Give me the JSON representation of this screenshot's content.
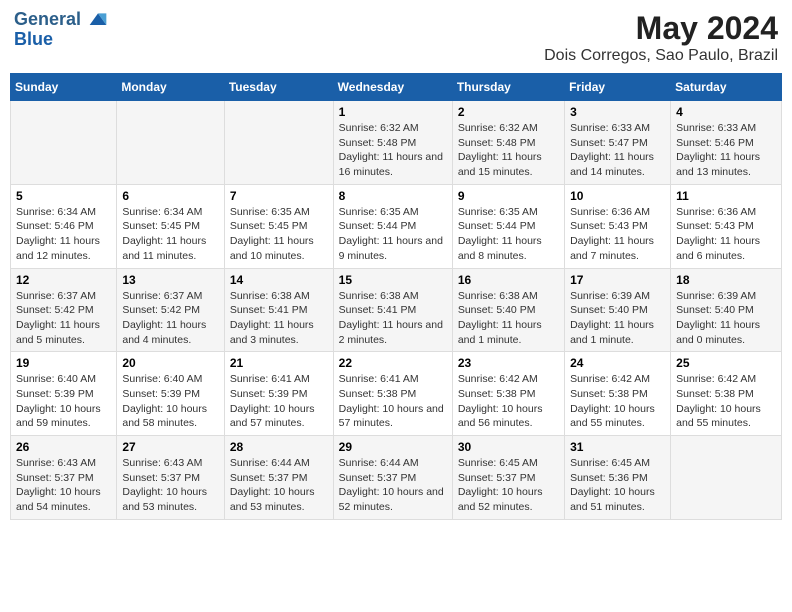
{
  "header": {
    "logo_line1": "General",
    "logo_line2": "Blue",
    "title": "May 2024",
    "subtitle": "Dois Corregos, Sao Paulo, Brazil"
  },
  "days_of_week": [
    "Sunday",
    "Monday",
    "Tuesday",
    "Wednesday",
    "Thursday",
    "Friday",
    "Saturday"
  ],
  "weeks": [
    [
      {
        "day": "",
        "info": ""
      },
      {
        "day": "",
        "info": ""
      },
      {
        "day": "",
        "info": ""
      },
      {
        "day": "1",
        "info": "Sunrise: 6:32 AM\nSunset: 5:48 PM\nDaylight: 11 hours and 16 minutes."
      },
      {
        "day": "2",
        "info": "Sunrise: 6:32 AM\nSunset: 5:48 PM\nDaylight: 11 hours and 15 minutes."
      },
      {
        "day": "3",
        "info": "Sunrise: 6:33 AM\nSunset: 5:47 PM\nDaylight: 11 hours and 14 minutes."
      },
      {
        "day": "4",
        "info": "Sunrise: 6:33 AM\nSunset: 5:46 PM\nDaylight: 11 hours and 13 minutes."
      }
    ],
    [
      {
        "day": "5",
        "info": "Sunrise: 6:34 AM\nSunset: 5:46 PM\nDaylight: 11 hours and 12 minutes."
      },
      {
        "day": "6",
        "info": "Sunrise: 6:34 AM\nSunset: 5:45 PM\nDaylight: 11 hours and 11 minutes."
      },
      {
        "day": "7",
        "info": "Sunrise: 6:35 AM\nSunset: 5:45 PM\nDaylight: 11 hours and 10 minutes."
      },
      {
        "day": "8",
        "info": "Sunrise: 6:35 AM\nSunset: 5:44 PM\nDaylight: 11 hours and 9 minutes."
      },
      {
        "day": "9",
        "info": "Sunrise: 6:35 AM\nSunset: 5:44 PM\nDaylight: 11 hours and 8 minutes."
      },
      {
        "day": "10",
        "info": "Sunrise: 6:36 AM\nSunset: 5:43 PM\nDaylight: 11 hours and 7 minutes."
      },
      {
        "day": "11",
        "info": "Sunrise: 6:36 AM\nSunset: 5:43 PM\nDaylight: 11 hours and 6 minutes."
      }
    ],
    [
      {
        "day": "12",
        "info": "Sunrise: 6:37 AM\nSunset: 5:42 PM\nDaylight: 11 hours and 5 minutes."
      },
      {
        "day": "13",
        "info": "Sunrise: 6:37 AM\nSunset: 5:42 PM\nDaylight: 11 hours and 4 minutes."
      },
      {
        "day": "14",
        "info": "Sunrise: 6:38 AM\nSunset: 5:41 PM\nDaylight: 11 hours and 3 minutes."
      },
      {
        "day": "15",
        "info": "Sunrise: 6:38 AM\nSunset: 5:41 PM\nDaylight: 11 hours and 2 minutes."
      },
      {
        "day": "16",
        "info": "Sunrise: 6:38 AM\nSunset: 5:40 PM\nDaylight: 11 hours and 1 minute."
      },
      {
        "day": "17",
        "info": "Sunrise: 6:39 AM\nSunset: 5:40 PM\nDaylight: 11 hours and 1 minute."
      },
      {
        "day": "18",
        "info": "Sunrise: 6:39 AM\nSunset: 5:40 PM\nDaylight: 11 hours and 0 minutes."
      }
    ],
    [
      {
        "day": "19",
        "info": "Sunrise: 6:40 AM\nSunset: 5:39 PM\nDaylight: 10 hours and 59 minutes."
      },
      {
        "day": "20",
        "info": "Sunrise: 6:40 AM\nSunset: 5:39 PM\nDaylight: 10 hours and 58 minutes."
      },
      {
        "day": "21",
        "info": "Sunrise: 6:41 AM\nSunset: 5:39 PM\nDaylight: 10 hours and 57 minutes."
      },
      {
        "day": "22",
        "info": "Sunrise: 6:41 AM\nSunset: 5:38 PM\nDaylight: 10 hours and 57 minutes."
      },
      {
        "day": "23",
        "info": "Sunrise: 6:42 AM\nSunset: 5:38 PM\nDaylight: 10 hours and 56 minutes."
      },
      {
        "day": "24",
        "info": "Sunrise: 6:42 AM\nSunset: 5:38 PM\nDaylight: 10 hours and 55 minutes."
      },
      {
        "day": "25",
        "info": "Sunrise: 6:42 AM\nSunset: 5:38 PM\nDaylight: 10 hours and 55 minutes."
      }
    ],
    [
      {
        "day": "26",
        "info": "Sunrise: 6:43 AM\nSunset: 5:37 PM\nDaylight: 10 hours and 54 minutes."
      },
      {
        "day": "27",
        "info": "Sunrise: 6:43 AM\nSunset: 5:37 PM\nDaylight: 10 hours and 53 minutes."
      },
      {
        "day": "28",
        "info": "Sunrise: 6:44 AM\nSunset: 5:37 PM\nDaylight: 10 hours and 53 minutes."
      },
      {
        "day": "29",
        "info": "Sunrise: 6:44 AM\nSunset: 5:37 PM\nDaylight: 10 hours and 52 minutes."
      },
      {
        "day": "30",
        "info": "Sunrise: 6:45 AM\nSunset: 5:37 PM\nDaylight: 10 hours and 52 minutes."
      },
      {
        "day": "31",
        "info": "Sunrise: 6:45 AM\nSunset: 5:36 PM\nDaylight: 10 hours and 51 minutes."
      },
      {
        "day": "",
        "info": ""
      }
    ]
  ]
}
